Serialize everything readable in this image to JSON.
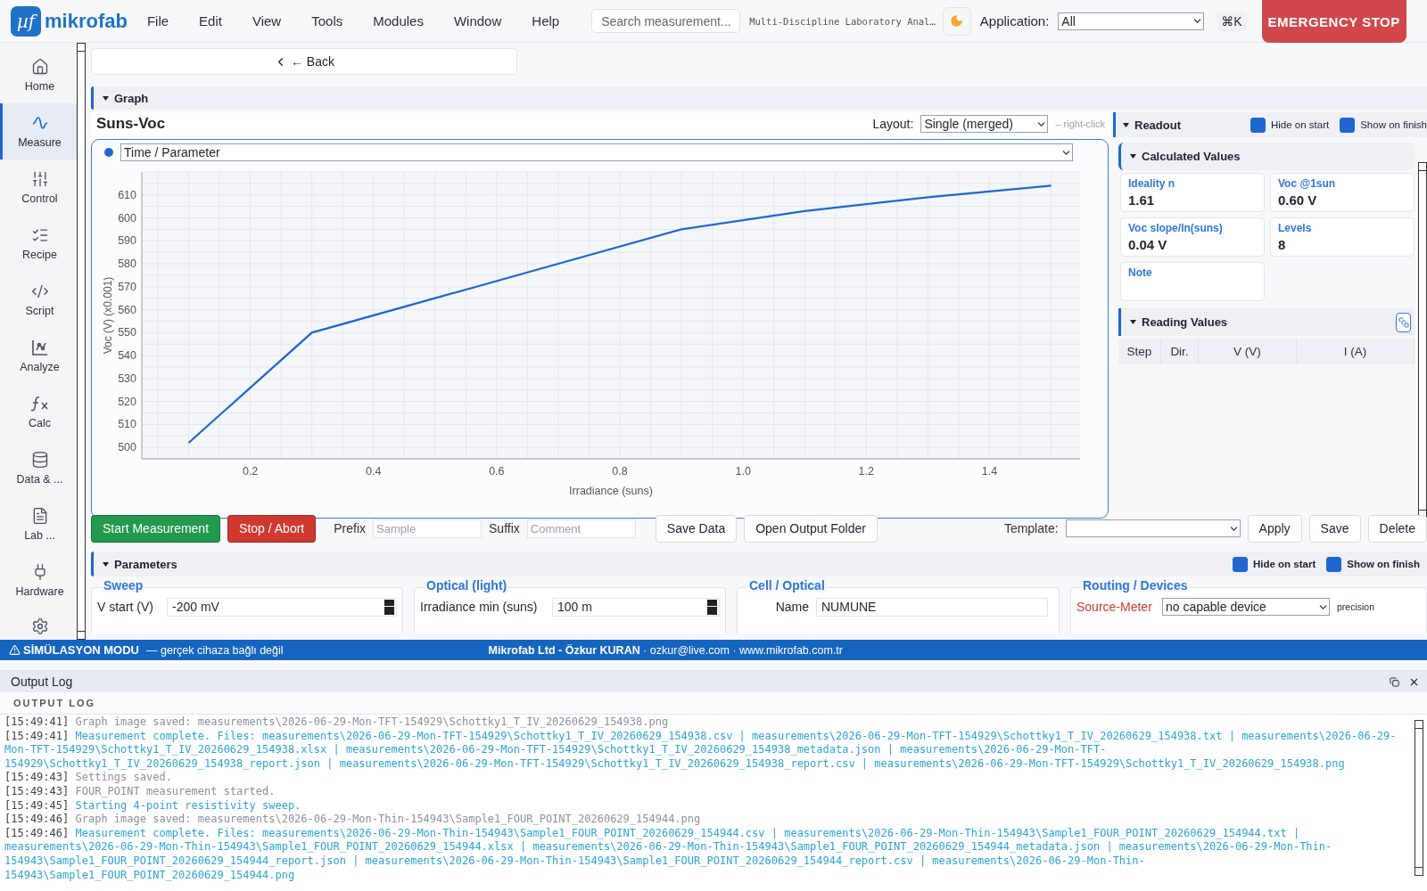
{
  "top_bar": {
    "logo_mark": "µf",
    "logo": "mikrofab",
    "menu": [
      "File",
      "Edit",
      "View",
      "Tools",
      "Modules",
      "Window",
      "Help"
    ],
    "search": {
      "placeholder": "Search measurement..."
    },
    "title": "Multi-Discipline Laboratory Anal…",
    "application": {
      "label": "Application:",
      "value": "All"
    },
    "shortcut": "⌘K",
    "emergency": "EMERGENCY STOP"
  },
  "sidebar": {
    "items": [
      {
        "label": "Home",
        "selected": false
      },
      {
        "label": "Measure",
        "selected": true
      },
      {
        "label": "Control",
        "selected": false
      },
      {
        "label": "Recipe",
        "selected": false
      },
      {
        "label": "Script",
        "selected": false
      },
      {
        "label": "Analyze",
        "selected": false
      },
      {
        "label": "Calc",
        "selected": false
      },
      {
        "label": "Data & ...",
        "selected": false
      },
      {
        "label": "Lab ...",
        "selected": false
      },
      {
        "label": "Hardware",
        "selected": false
      }
    ]
  },
  "back_button": "← Back",
  "graph": {
    "section": "Graph",
    "title": "Suns-Voc",
    "layout_label": "Layout:",
    "layout": "Single (merged)",
    "hint": "– right-click",
    "series_select": "Time / Parameter",
    "chart_data": {
      "type": "line",
      "xlabel": "Irradiance (suns)",
      "ylabel": "Voc (V) (x0.001)",
      "x": [
        0.1,
        0.3,
        0.5,
        0.7,
        0.9,
        1.1,
        1.3,
        1.5
      ],
      "grid": true,
      "series": [
        {
          "color": "#1f66d1",
          "values": [
            502,
            550,
            565,
            580,
            595,
            603,
            609,
            614
          ]
        }
      ],
      "xlim": [
        0.024,
        1.547
      ],
      "ylim": [
        495,
        620
      ],
      "xticks": [
        {
          "value": 0.2,
          "label": "0.2"
        },
        {
          "value": 0.4,
          "label": "0.4"
        },
        {
          "value": 0.6,
          "label": "0.6"
        },
        {
          "value": 0.8,
          "label": "0.8"
        },
        {
          "value": 1,
          "label": "1.0"
        },
        {
          "value": 1.2,
          "label": "1.2"
        },
        {
          "value": 1.4,
          "label": "1.4"
        }
      ],
      "yticks": [
        500,
        510,
        520,
        530,
        540,
        550,
        560,
        570,
        580,
        590,
        600,
        610
      ]
    }
  },
  "readout": {
    "title": "Readout",
    "toggles": [
      {
        "label": "Hide on start",
        "checked": true
      },
      {
        "label": "Show on finish",
        "checked": true
      }
    ],
    "calculated": {
      "title": "Calculated Values",
      "cards": [
        {
          "label": "Ideality n",
          "value": "1.61"
        },
        {
          "label": "Voc @1sun",
          "value": "0.60 V"
        },
        {
          "label": "Voc slope/ln(suns)",
          "value": "0.04 V"
        },
        {
          "label": "Levels",
          "value": "8"
        },
        {
          "label": "Note"
        }
      ]
    },
    "reading": {
      "title": "Reading Values",
      "columns": [
        "Step",
        "Dir.",
        "V (V)",
        "I (A)"
      ]
    }
  },
  "actions": {
    "start": "Start Measurement",
    "stop": "Stop / Abort",
    "prefix": {
      "label": "Prefix",
      "placeholder": "Sample"
    },
    "suffix": {
      "label": "Suffix",
      "placeholder": "Comment"
    },
    "save_data": "Save Data",
    "open_folder": "Open Output Folder",
    "template_label": "Template:",
    "buttons": [
      "Apply",
      "Save",
      "Delete"
    ]
  },
  "parameters": {
    "title": "Parameters",
    "toggles": [
      {
        "label": "Hide on start",
        "checked": true
      },
      {
        "label": "Show on finish",
        "checked": true
      }
    ],
    "groups": [
      {
        "title": "Sweep",
        "rows": [
          {
            "kind": "field",
            "label": "V start (V)",
            "value": "-200 mV"
          }
        ]
      },
      {
        "title": "Optical (light)",
        "rows": [
          {
            "kind": "field",
            "label": "Irradiance min (suns)",
            "value": "100 m"
          }
        ]
      },
      {
        "title": "Cell / Optical",
        "rows": [
          {
            "kind": "text",
            "label": "Name",
            "value": "NUMUNE"
          }
        ]
      },
      {
        "title": "Routing / Devices",
        "rows": [
          {
            "kind": "device",
            "label": "Source-Meter",
            "value": "no capable device",
            "extra": "precision"
          }
        ]
      }
    ]
  },
  "status_bar": {
    "mode": "SİMÜLASYON MODU",
    "mode_note": "— gerçek cihaza bağlı değil",
    "credits": "**Mikrofab Ltd - Özkur KURAN** · ozkur@live.com · www.mikrofab.com.tr"
  },
  "output_log": {
    "title": "Output Log",
    "subtitle": "OUTPUT LOG",
    "lines": [
      {
        "kind": "info",
        "time": "[15:49:41]",
        "text": "Graph image saved: measurements\\2026-06-29-Mon-TFT-154929\\Schottky1_T_IV_20260629_154938.png"
      },
      {
        "kind": "success",
        "time": "[15:49:41]",
        "text": "Measurement complete. Files: measurements\\2026-06-29-Mon-TFT-154929\\Schottky1_T_IV_20260629_154938.csv | measurements\\2026-06-29-Mon-TFT-154929\\Schottky1_T_IV_20260629_154938.txt | measurements\\2026-06-29-Mon-TFT-154929\\Schottky1_T_IV_20260629_154938.xlsx | measurements\\2026-06-29-Mon-TFT-154929\\Schottky1_T_IV_20260629_154938_metadata.json | measurements\\2026-06-29-Mon-TFT-154929\\Schottky1_T_IV_20260629_154938_report.json | measurements\\2026-06-29-Mon-TFT-154929\\Schottky1_T_IV_20260629_154938_report.csv | measurements\\2026-06-29-Mon-TFT-154929\\Schottky1_T_IV_20260629_154938.png"
      },
      {
        "kind": "info",
        "time": "[15:49:43]",
        "text": "Settings saved."
      },
      {
        "kind": "info",
        "time": "[15:49:43]",
        "text": "FOUR_POINT measurement started."
      },
      {
        "kind": "success",
        "time": "[15:49:45]",
        "text": "Starting 4-point resistivity sweep."
      },
      {
        "kind": "info",
        "time": "[15:49:46]",
        "text": "Graph image saved: measurements\\2026-06-29-Mon-Thin-154943\\Sample1_FOUR_POINT_20260629_154944.png"
      },
      {
        "kind": "success",
        "time": "[15:49:46]",
        "text": "Measurement complete. Files: measurements\\2026-06-29-Mon-Thin-154943\\Sample1_FOUR_POINT_20260629_154944.csv | measurements\\2026-06-29-Mon-Thin-154943\\Sample1_FOUR_POINT_20260629_154944.txt | measurements\\2026-06-29-Mon-Thin-154943\\Sample1_FOUR_POINT_20260629_154944.xlsx | measurements\\2026-06-29-Mon-Thin-154943\\Sample1_FOUR_POINT_20260629_154944_metadata.json | measurements\\2026-06-29-Mon-Thin-154943\\Sample1_FOUR_POINT_20260629_154944_report.json | measurements\\2026-06-29-Mon-Thin-154943\\Sample1_FOUR_POINT_20260629_154944_report.csv | measurements\\2026-06-29-Mon-Thin-154943\\Sample1_FOUR_POINT_20260629_154944.png"
      }
    ]
  }
}
